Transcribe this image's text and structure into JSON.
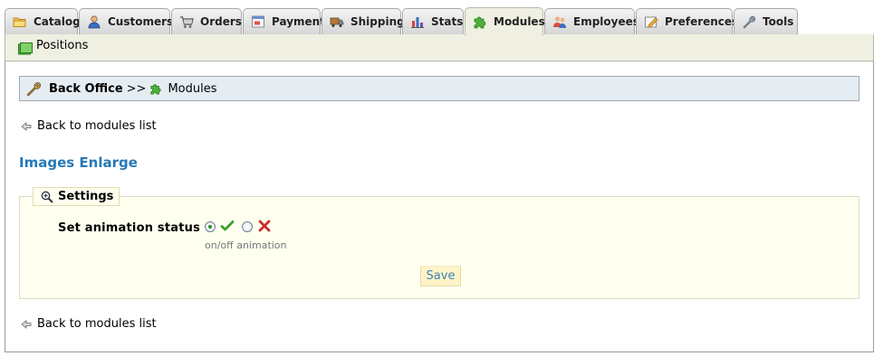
{
  "tabs": [
    {
      "label": "Catalog",
      "icon": "folder-icon",
      "active": false
    },
    {
      "label": "Customers",
      "icon": "customers-icon",
      "active": false
    },
    {
      "label": "Orders",
      "icon": "cart-icon",
      "active": false
    },
    {
      "label": "Payment",
      "icon": "payment-icon",
      "active": false
    },
    {
      "label": "Shipping",
      "icon": "truck-icon",
      "active": false
    },
    {
      "label": "Stats",
      "icon": "stats-icon",
      "active": false
    },
    {
      "label": "Modules",
      "icon": "puzzle-icon",
      "active": true
    },
    {
      "label": "Employees",
      "icon": "employees-icon",
      "active": false
    },
    {
      "label": "Preferences",
      "icon": "preferences-icon",
      "active": false
    },
    {
      "label": "Tools",
      "icon": "wrench-icon",
      "active": false
    }
  ],
  "subbar": {
    "label": "Positions",
    "icon": "positions-icon"
  },
  "breadcrumb": {
    "home": "Back Office",
    "separator": ">>",
    "current": "Modules"
  },
  "back_link_top": "Back to modules list",
  "back_link_bottom": "Back to modules list",
  "module_title": "Images Enlarge",
  "settings": {
    "legend": "Settings",
    "field_label": "Set animation status",
    "options": [
      {
        "value": "on",
        "icon": "check-icon",
        "checked": true
      },
      {
        "value": "off",
        "icon": "cross-icon",
        "checked": false
      }
    ],
    "hint": "on/off animation",
    "save_label": "Save"
  },
  "colors": {
    "title": "#2679b8",
    "active_tab": "#efefe2",
    "breadcrumb_bg": "#e6edf2",
    "fieldset_bg": "#fffff0",
    "save_bg": "#fff4c8"
  }
}
